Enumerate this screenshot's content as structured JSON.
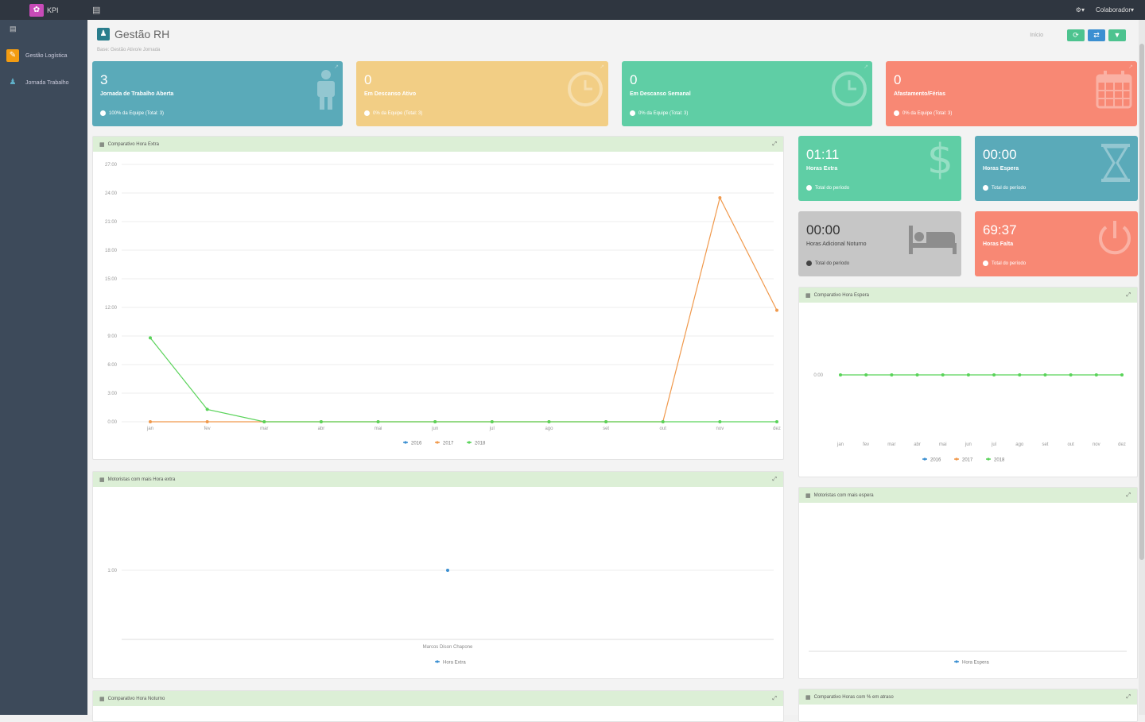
{
  "topbar": {
    "brand_icon": "flower-icon",
    "brand": "KPI",
    "right_user": "Colaborador",
    "right_settings": "⚙▾"
  },
  "sidebar": {
    "toggle_icon": "menu-icon",
    "items": [
      {
        "label": "Gestão Logística",
        "icon": "clipboard-icon",
        "color": "#f39c12"
      },
      {
        "label": "Jornada Trabalho",
        "icon": "user-icon",
        "color": "#2a7d8c"
      }
    ]
  },
  "page": {
    "title": "Gestão RH",
    "subtitle": "Base: Gestão Ativo/e Jornada",
    "link": "Início",
    "buttons": [
      "refresh-icon",
      "sync-icon",
      "filter-icon"
    ]
  },
  "cards_top": [
    {
      "value": "3",
      "label": "Jornada de Trabalho Aberta",
      "footer": "100% da Equipe (Total: 3)",
      "color": "#5aaab9",
      "icon": "person-icon"
    },
    {
      "value": "0",
      "label": "Em Descanso Ativo",
      "footer": "0% da Equipe (Total: 3)",
      "color": "#f2ce85",
      "icon": "clock-icon"
    },
    {
      "value": "0",
      "label": "Em Descanso Semanal",
      "footer": "0% da Equipe (Total: 3)",
      "color": "#5fcea5",
      "icon": "clock-icon"
    },
    {
      "value": "0",
      "label": "Afastamento/Férias",
      "footer": "0% da Equipe (Total: 3)",
      "color": "#f88874",
      "icon": "calendar-icon"
    }
  ],
  "cards_small": [
    {
      "value": "01:11",
      "label": "Horas Extra",
      "footer": "Total do período",
      "color": "#5fcea5",
      "icon": "dollar-icon"
    },
    {
      "value": "00:00",
      "label": "Horas Espera",
      "footer": "Total do período",
      "color": "#5aaab9",
      "icon": "hourglass-icon"
    },
    {
      "value": "00:00",
      "label": "Horas Adicional Noturno",
      "footer": "Total do período",
      "color": "#c6c6c6",
      "icon": "bed-icon"
    },
    {
      "value": "69:37",
      "label": "Horas Falta",
      "footer": "Total do período",
      "color": "#f88874",
      "icon": "power-icon"
    }
  ],
  "panels": {
    "p1_title": "Comparativo Hora Extra",
    "p2_title": "Motoristas com mais Hora extra",
    "p3_title": "Comparativo Hora Espera",
    "p4_title": "Motoristas com mais espera",
    "p5_title": "Comparativo Hora Noturno",
    "p6_title": "Comparativo Horas com % em atraso"
  },
  "chart_data": [
    {
      "type": "line",
      "title": "",
      "categories": [
        "jan",
        "fev",
        "mar",
        "abr",
        "mai",
        "jun",
        "jul",
        "ago",
        "set",
        "out",
        "nov",
        "dez"
      ],
      "y_ticks": [
        "0:00",
        "3:00",
        "6:00",
        "9:00",
        "12:00",
        "15:00",
        "18:00",
        "21:00",
        "24:00",
        "27:00"
      ],
      "ylim": [
        0,
        27
      ],
      "legend_position": "bottom",
      "series": [
        {
          "name": "2016",
          "color": "#3b8fd1",
          "values": [
            null,
            null,
            null,
            null,
            null,
            null,
            null,
            null,
            null,
            null,
            null,
            null
          ]
        },
        {
          "name": "2017",
          "color": "#f0994c",
          "values": [
            0,
            0,
            0,
            0,
            0,
            0,
            0,
            0,
            0,
            0,
            23.5,
            11.7
          ]
        },
        {
          "name": "2018",
          "color": "#5ad35a",
          "values": [
            8.8,
            1.3,
            0,
            0,
            0,
            0,
            0,
            0,
            0,
            0,
            0,
            0
          ]
        }
      ]
    },
    {
      "type": "scatter",
      "title": "",
      "xlabel": "Marcos Dison Chapone",
      "y_ticks": [
        "1:00"
      ],
      "legend_position": "bottom",
      "series": [
        {
          "name": "Hora Extra",
          "color": "#3b8fd1",
          "values": [
            1
          ]
        }
      ]
    },
    {
      "type": "line",
      "title": "",
      "categories": [
        "jan",
        "fev",
        "mar",
        "abr",
        "mai",
        "jun",
        "jul",
        "ago",
        "set",
        "out",
        "nov",
        "dez"
      ],
      "y_ticks": [
        "0:00"
      ],
      "legend_position": "bottom",
      "series": [
        {
          "name": "2016",
          "color": "#3b8fd1",
          "values": [
            null,
            null,
            null,
            null,
            null,
            null,
            null,
            null,
            null,
            null,
            null,
            null
          ]
        },
        {
          "name": "2017",
          "color": "#f0994c",
          "values": [
            null,
            null,
            null,
            null,
            null,
            null,
            null,
            null,
            null,
            null,
            null,
            null
          ]
        },
        {
          "name": "2018",
          "color": "#5ad35a",
          "values": [
            0,
            0,
            0,
            0,
            0,
            0,
            0,
            0,
            0,
            0,
            0,
            0
          ]
        }
      ]
    },
    {
      "type": "bar",
      "title": "",
      "legend_position": "bottom",
      "series": [
        {
          "name": "Hora Espera",
          "color": "#3b8fd1",
          "values": []
        }
      ]
    }
  ]
}
